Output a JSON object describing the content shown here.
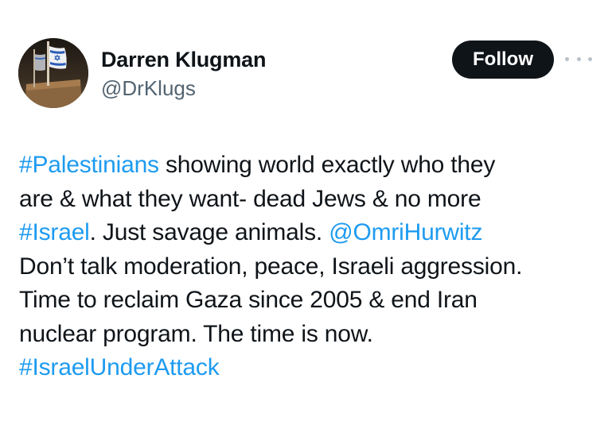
{
  "author": {
    "display_name": "Darren Klugman",
    "handle": "@DrKlugs",
    "avatar_icon": "israeli-flag-avatar"
  },
  "actions": {
    "follow_label": "Follow",
    "more_icon": "more-horizontal-icon"
  },
  "tweet": {
    "lines": [
      [
        {
          "text": "#Palestinians",
          "type": "hashtag"
        },
        {
          "text": " showing world exactly who they",
          "type": "text"
        }
      ],
      [
        {
          "text": "are & what they want- dead Jews & no more",
          "type": "text"
        }
      ],
      [
        {
          "text": "#Israel",
          "type": "hashtag"
        },
        {
          "text": ". Just savage animals. ",
          "type": "text"
        },
        {
          "text": "@OmriHurwitz",
          "type": "mention"
        }
      ],
      [
        {
          "text": "Don’t talk moderation, peace, Israeli aggression.",
          "type": "text"
        }
      ],
      [
        {
          "text": "Time to reclaim Gaza since 2005 & end Iran",
          "type": "text"
        }
      ],
      [
        {
          "text": "nuclear program. The time is now.",
          "type": "text"
        }
      ],
      [
        {
          "text": "#IsraelUnderAttack",
          "type": "hashtag"
        }
      ]
    ]
  },
  "colors": {
    "link": "#1d9bf0",
    "text": "#0f1419",
    "secondary": "#536471",
    "follow_bg": "#0f1419"
  }
}
